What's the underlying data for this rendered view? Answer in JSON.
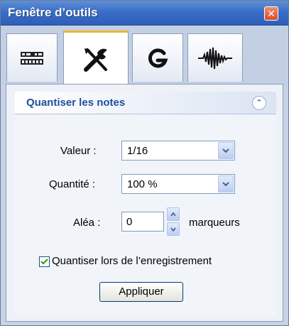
{
  "window": {
    "title": "Fenêtre d’outils",
    "close_glyph": "✕"
  },
  "tabs": [
    {
      "icon": "mixer-icon",
      "active": false
    },
    {
      "icon": "tools-icon",
      "active": true
    },
    {
      "icon": "g-icon",
      "active": false
    },
    {
      "icon": "waveform-icon",
      "active": false
    }
  ],
  "panel": {
    "title": "Quantiser les notes",
    "collapse_glyph": "⌃"
  },
  "form": {
    "value_label": "Valeur :",
    "value_selected": "1/16",
    "quantity_label": "Quantité :",
    "quantity_selected": "100 %",
    "random_label": "Aléa :",
    "random_value": "0",
    "random_unit": "marqueurs",
    "quantize_on_record_label": "Quantiser lors de l’enregistrement",
    "quantize_on_record_checked": true,
    "apply_label": "Appliquer"
  },
  "colors": {
    "titlebar": "#3b6ec7",
    "panel_title": "#1f4f9b",
    "active_tab_accent": "#f0b432"
  }
}
